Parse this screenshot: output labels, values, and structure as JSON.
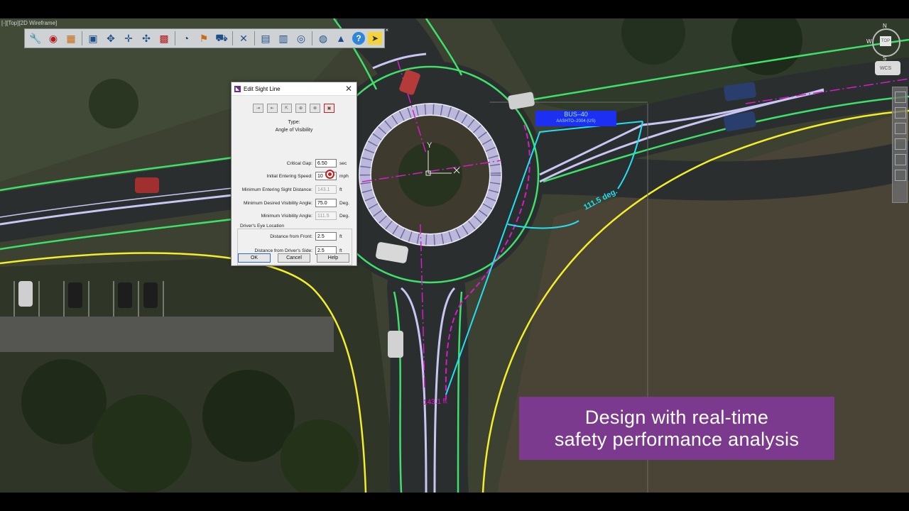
{
  "viewport": {
    "label": "[-][Top][2D Wireframe]"
  },
  "toolbar": {
    "buttons": [
      {
        "name": "settings-wrench-icon",
        "glyph": "🔧"
      },
      {
        "name": "palette-icon",
        "glyph": "◉"
      },
      {
        "name": "print-icon",
        "glyph": "▦"
      },
      {
        "name": "document-icon",
        "glyph": "▣"
      },
      {
        "name": "pan-icon",
        "glyph": "✥"
      },
      {
        "name": "move-icon",
        "glyph": "✛"
      },
      {
        "name": "rotate-icon",
        "glyph": "✣"
      },
      {
        "name": "grid-icon",
        "glyph": "▩"
      },
      {
        "name": "speed-icon",
        "glyph": "◔"
      },
      {
        "name": "sign-icon",
        "glyph": "⚑"
      },
      {
        "name": "truck-icon",
        "glyph": "⛟"
      },
      {
        "name": "cross-icon",
        "glyph": "✕"
      },
      {
        "name": "film-icon",
        "glyph": "▤"
      },
      {
        "name": "report-icon",
        "glyph": "▥"
      },
      {
        "name": "eye-icon",
        "glyph": "◎"
      },
      {
        "name": "globe-icon",
        "glyph": "◍"
      },
      {
        "name": "learn-icon",
        "glyph": "▲"
      },
      {
        "name": "help-icon",
        "glyph": "?"
      },
      {
        "name": "arrow-icon",
        "glyph": "➤"
      }
    ],
    "close_glyph": "×"
  },
  "viewcube": {
    "north": "N",
    "south": "S",
    "west": "W",
    "top": "TOP",
    "wcs": "WCS"
  },
  "dialog": {
    "title": "Edit Sight Line",
    "close_glyph": "✕",
    "type_label": "Type:",
    "type_value": "Angle of Visibility",
    "critical_gap": {
      "label": "Critical Gap:",
      "value": "6.50",
      "unit": "sec"
    },
    "entering_speed": {
      "label": "Initial Entering Speed:",
      "value": "10",
      "unit": "mph"
    },
    "min_entering_sight": {
      "label": "Minimum Entering Sight Distance:",
      "value": "143.1",
      "unit": "ft"
    },
    "min_desired_angle": {
      "label": "Minimum Desired Visibility Angle:",
      "value": "75.0",
      "unit": "Deg."
    },
    "min_visibility_angle": {
      "label": "Minimum Visibility Angle:",
      "value": "111.5",
      "unit": "Deg."
    },
    "eye_group_label": "Driver's Eye Location",
    "distance_front": {
      "label": "Distance from Front:",
      "value": "2.5",
      "unit": "ft"
    },
    "distance_side": {
      "label": "Distance from Driver's Side:",
      "value": "2.5",
      "unit": "ft"
    },
    "ok_label": "OK",
    "cancel_label": "Cancel",
    "help_label": "Help"
  },
  "map": {
    "bus_label_main": "BUS–40",
    "bus_label_sub": "AASHTO–2004 (US)",
    "angle_label": "111.5 deg.",
    "distance_label": "143.1 ft",
    "axis_y": "Y"
  },
  "promo": {
    "line1": "Design with real-time",
    "line2": "safety performance analysis",
    "color": "#7b3a8e"
  }
}
